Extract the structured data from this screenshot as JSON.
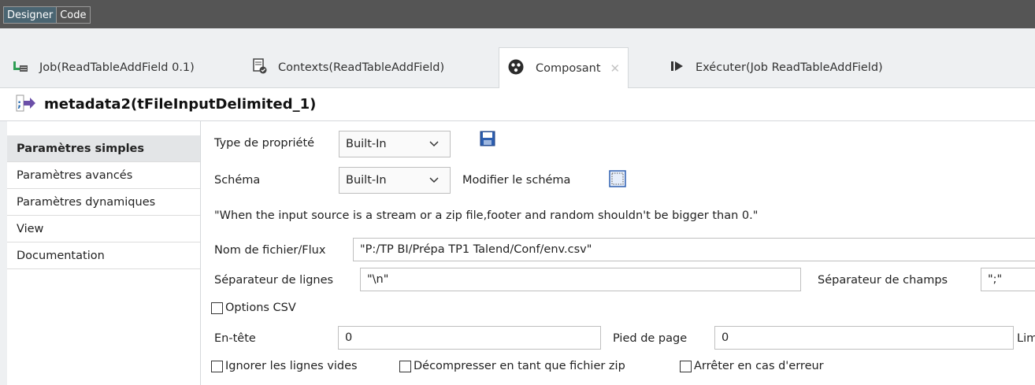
{
  "topbar": {
    "tabs": [
      "Designer",
      "Code"
    ]
  },
  "view_tabs": [
    {
      "label": "Job(ReadTableAddField 0.1)",
      "icon": "job-icon"
    },
    {
      "label": "Contexts(ReadTableAddField)",
      "icon": "contexts-icon"
    },
    {
      "label": "Composant",
      "icon": "component-icon",
      "active": true
    },
    {
      "label": "Exécuter(Job ReadTableAddField)",
      "icon": "run-icon"
    }
  ],
  "component": {
    "title": "metadata2(tFileInputDelimited_1)"
  },
  "nav": {
    "items": [
      "Paramètres simples",
      "Paramètres avancés",
      "Paramètres dynamiques",
      "View",
      "Documentation"
    ],
    "selected": "Paramètres simples"
  },
  "form": {
    "property_type_label": "Type de propriété",
    "property_type_value": "Built-In",
    "schema_label": "Schéma",
    "schema_value": "Built-In",
    "edit_schema_label": "Modifier le schéma",
    "note": "\"When the input source is a stream or a zip file,footer and random shouldn't be bigger than 0.\"",
    "filename_label": "Nom de fichier/Flux",
    "filename_value": "\"P:/TP BI/Prépa TP1 Talend/Conf/env.csv\"",
    "row_sep_label": "Séparateur de lignes",
    "row_sep_value": "\"\\n\"",
    "field_sep_label": "Séparateur de champs",
    "field_sep_value": "\";\"",
    "csv_options_label": "Options CSV",
    "header_label": "En-tête",
    "header_value": "0",
    "footer_label": "Pied de page",
    "footer_value": "0",
    "limit_label": "Limi",
    "ignore_empty_label": "Ignorer les lignes vides",
    "decompress_label": "Décompresser en tant que fichier zip",
    "stop_on_error_label": "Arrêter en cas d'erreur"
  }
}
